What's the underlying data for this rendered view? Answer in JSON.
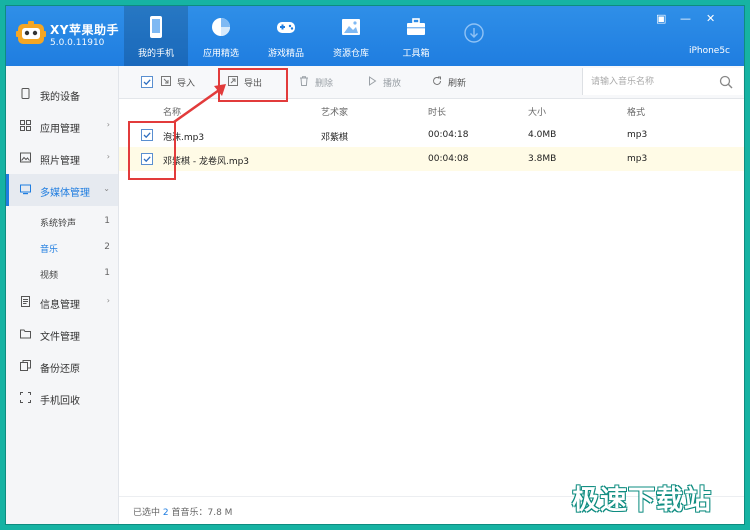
{
  "app": {
    "title": "XY苹果助手",
    "version": "5.0.0.11910",
    "device": "iPhone5c"
  },
  "window_controls": {
    "skin": "▣",
    "min": "—",
    "close": "✕"
  },
  "nav_tabs": [
    {
      "label": "我的手机"
    },
    {
      "label": "应用精选"
    },
    {
      "label": "游戏精品"
    },
    {
      "label": "资源仓库"
    },
    {
      "label": "工具箱"
    }
  ],
  "sidebar": {
    "items": [
      {
        "label": "我的设备"
      },
      {
        "label": "应用管理"
      },
      {
        "label": "照片管理"
      },
      {
        "label": "多媒体管理"
      },
      {
        "label": "信息管理"
      },
      {
        "label": "文件管理"
      },
      {
        "label": "备份还原"
      },
      {
        "label": "手机回收"
      }
    ],
    "subitems": [
      {
        "label": "系统铃声",
        "count": "1"
      },
      {
        "label": "音乐",
        "count": "2"
      },
      {
        "label": "视频",
        "count": "1"
      }
    ]
  },
  "toolbar": {
    "import": "导入",
    "export": "导出",
    "delete": "删除",
    "play": "播放",
    "refresh": "刷新",
    "search_placeholder": "请输入音乐名称"
  },
  "table": {
    "headers": {
      "name": "名称",
      "artist": "艺术家",
      "duration": "时长",
      "size": "大小",
      "format": "格式"
    },
    "rows": [
      {
        "name": "泡沫.mp3",
        "artist": "邓紫棋",
        "duration": "00:04:18",
        "size": "4.0MB",
        "format": "mp3"
      },
      {
        "name": "邓紫棋 - 龙卷风.mp3",
        "artist": "",
        "duration": "00:04:08",
        "size": "3.8MB",
        "format": "mp3"
      }
    ]
  },
  "footer": {
    "prefix": "已选中",
    "count": "2",
    "suffix": "首音乐：7.8 M"
  },
  "watermark": "极速下载站",
  "colors": {
    "accent": "#1f7de0",
    "annotation": "#e23b3b",
    "frame": "#16b3a3"
  }
}
